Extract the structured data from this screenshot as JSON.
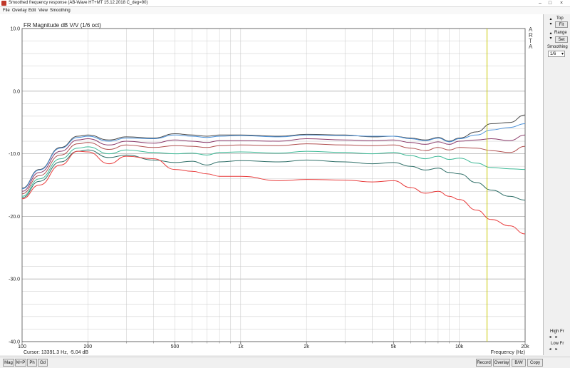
{
  "window": {
    "title": "Smoothed frequency response (AB-Wave HT+MT 15.12.2018 C_deg=90)",
    "controls": [
      "–",
      "□",
      "×"
    ]
  },
  "menu": [
    "File",
    "Overlay",
    "Edit",
    "View",
    "Smoothing"
  ],
  "sidebar": {
    "top_label": "Top",
    "fit_label": "Fit",
    "range_label": "Range",
    "set_label": "Set",
    "smoothing_label": "Smoothing",
    "smoothing_value": "1/6",
    "highfr_label": "High Fr",
    "lowfr_label": "Low Fr"
  },
  "bottom_tabs": [
    "Mag",
    "M+P",
    "Ph",
    "Gd"
  ],
  "bottom_actions": [
    "Record",
    "Overlay",
    "B/W",
    "Copy"
  ],
  "chart_data": {
    "type": "line",
    "title": "FR Magnitude dB V/V (1/6 oct)",
    "watermark": "ARTA",
    "xlabel": "Frequency (Hz)",
    "ylabel": "",
    "cursor_text": "Cursor: 13391.3 Hz, -5.04 dB",
    "x_scale": "log",
    "xlim": [
      100,
      20000
    ],
    "ylim": [
      -40,
      10
    ],
    "y_ticks": [
      10,
      0,
      -10,
      -20,
      -30,
      -40
    ],
    "y_tick_labels": [
      "10.0",
      "0.0",
      "-10.0",
      "-20.0",
      "-30.0",
      "-40.0"
    ],
    "x_ticks_labeled": [
      100,
      200,
      500,
      1000,
      2000,
      5000,
      10000,
      20000
    ],
    "x_tick_labels": [
      "100",
      "200",
      "500",
      "1k",
      "2k",
      "5k",
      "10k",
      "20k"
    ],
    "x_minor_ticks": [
      300,
      400,
      600,
      700,
      800,
      900,
      3000,
      4000,
      6000,
      7000,
      8000,
      9000
    ],
    "grid": true,
    "cursor_x": 13391.3,
    "cursor_color": "#c8c800",
    "background": "#ffffff",
    "grid_color": "#c8c8c8",
    "series": [
      {
        "color": "#4b4b4b",
        "x": [
          100,
          120,
          150,
          180,
          200,
          250,
          300,
          400,
          500,
          600,
          700,
          800,
          1000,
          1500,
          2000,
          3000,
          4000,
          5000,
          6000,
          7000,
          8000,
          9000,
          10000,
          12000,
          14000,
          17000,
          20000
        ],
        "y": [
          -15.5,
          -12.5,
          -9.0,
          -7.2,
          -7.0,
          -7.8,
          -7.3,
          -7.5,
          -6.8,
          -7.0,
          -7.2,
          -7.0,
          -7.0,
          -7.2,
          -6.9,
          -7.0,
          -7.3,
          -7.2,
          -7.5,
          -7.8,
          -7.4,
          -8.0,
          -7.5,
          -6.5,
          -5.2,
          -5.0,
          -3.8
        ]
      },
      {
        "color": "#4a90d9",
        "x": [
          100,
          120,
          150,
          180,
          200,
          250,
          300,
          400,
          500,
          600,
          700,
          800,
          1000,
          1500,
          2000,
          3000,
          4000,
          5000,
          6000,
          7000,
          8000,
          9000,
          10000,
          12000,
          14000,
          17000,
          20000
        ],
        "y": [
          -15.6,
          -12.6,
          -9.1,
          -7.4,
          -7.2,
          -8.0,
          -7.5,
          -7.6,
          -7.0,
          -7.2,
          -7.4,
          -7.2,
          -7.1,
          -7.3,
          -7.0,
          -7.1,
          -7.2,
          -7.2,
          -7.6,
          -7.9,
          -7.5,
          -8.1,
          -7.6,
          -7.0,
          -6.2,
          -5.8,
          -5.2
        ]
      },
      {
        "color": "#8a3a6a",
        "x": [
          100,
          120,
          150,
          180,
          200,
          250,
          300,
          400,
          500,
          600,
          700,
          800,
          1000,
          1500,
          2000,
          3000,
          4000,
          5000,
          6000,
          7000,
          8000,
          9000,
          10000,
          12000,
          14000,
          17000,
          20000
        ],
        "y": [
          -16.0,
          -13.0,
          -9.6,
          -7.8,
          -7.6,
          -8.6,
          -8.0,
          -8.3,
          -7.8,
          -8.0,
          -8.2,
          -7.9,
          -7.9,
          -8.0,
          -7.6,
          -7.8,
          -7.9,
          -7.8,
          -8.2,
          -8.5,
          -8.1,
          -8.5,
          -8.0,
          -7.8,
          -7.6,
          -7.9,
          -7.0
        ]
      },
      {
        "color": "#b05050",
        "x": [
          100,
          120,
          150,
          180,
          200,
          250,
          300,
          400,
          500,
          600,
          700,
          800,
          1000,
          1500,
          2000,
          3000,
          4000,
          5000,
          6000,
          7000,
          8000,
          9000,
          10000,
          12000,
          14000,
          17000,
          20000
        ],
        "y": [
          -16.4,
          -13.5,
          -10.2,
          -8.4,
          -8.2,
          -9.3,
          -8.6,
          -9.0,
          -8.7,
          -8.8,
          -9.0,
          -8.7,
          -8.6,
          -8.7,
          -8.4,
          -8.6,
          -8.7,
          -8.6,
          -9.1,
          -9.5,
          -9.0,
          -9.4,
          -9.0,
          -9.1,
          -9.5,
          -9.8,
          -8.8
        ]
      },
      {
        "color": "#3cb895",
        "x": [
          100,
          120,
          150,
          180,
          200,
          250,
          300,
          400,
          500,
          600,
          700,
          800,
          1000,
          1500,
          2000,
          3000,
          4000,
          5000,
          6000,
          7000,
          8000,
          9000,
          10000,
          12000,
          14000,
          17000,
          20000
        ],
        "y": [
          -16.8,
          -14.0,
          -10.8,
          -9.1,
          -8.9,
          -10.0,
          -9.4,
          -9.8,
          -10.0,
          -9.9,
          -10.2,
          -9.8,
          -9.7,
          -9.9,
          -9.6,
          -9.8,
          -10.0,
          -9.8,
          -10.3,
          -10.8,
          -10.4,
          -10.9,
          -10.7,
          -11.5,
          -12.2,
          -12.4,
          -12.5
        ]
      },
      {
        "color": "#2f6f68",
        "x": [
          100,
          120,
          150,
          180,
          200,
          250,
          300,
          400,
          500,
          600,
          700,
          800,
          1000,
          1500,
          2000,
          3000,
          4000,
          5000,
          6000,
          7000,
          8000,
          9000,
          10000,
          12000,
          14000,
          17000,
          20000
        ],
        "y": [
          -17.0,
          -14.4,
          -11.3,
          -9.6,
          -9.4,
          -10.6,
          -10.2,
          -11.0,
          -11.4,
          -11.2,
          -11.8,
          -11.3,
          -11.1,
          -11.3,
          -11.0,
          -11.3,
          -11.6,
          -11.4,
          -12.0,
          -12.6,
          -12.3,
          -13.0,
          -13.2,
          -14.6,
          -15.8,
          -16.8,
          -17.4
        ]
      },
      {
        "color": "#e83b3b",
        "x": [
          100,
          120,
          150,
          180,
          200,
          250,
          300,
          400,
          500,
          600,
          700,
          800,
          1000,
          1500,
          2000,
          3000,
          4000,
          5000,
          6000,
          7000,
          8000,
          9000,
          10000,
          12000,
          14000,
          17000,
          20000
        ],
        "y": [
          -17.2,
          -15.0,
          -11.8,
          -9.6,
          -9.7,
          -11.6,
          -10.4,
          -10.8,
          -12.5,
          -12.8,
          -13.2,
          -13.6,
          -13.6,
          -14.3,
          -14.1,
          -14.2,
          -14.5,
          -14.3,
          -15.4,
          -16.3,
          -16.0,
          -16.8,
          -17.3,
          -19.0,
          -20.5,
          -21.5,
          -22.8
        ]
      }
    ]
  }
}
